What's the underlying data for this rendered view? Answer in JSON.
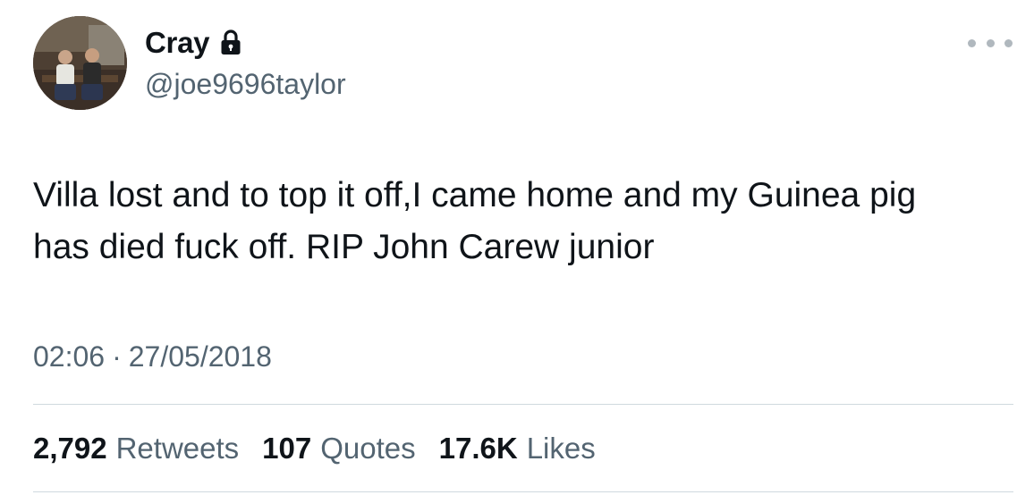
{
  "user": {
    "display_name": "Cray",
    "handle": "@joe9696taylor",
    "protected_icon": "lock-icon",
    "avatar_description": "photo-avatar"
  },
  "tweet": {
    "text": "Villa lost and to top it off,I came home and my Guinea pig\nhas died fuck off. RIP John Carew junior",
    "time": "02:06",
    "separator": "·",
    "date": "27/05/2018"
  },
  "stats": {
    "retweets_count": "2,792",
    "retweets_label": "Retweets",
    "quotes_count": "107",
    "quotes_label": "Quotes",
    "likes_count": "17.6K",
    "likes_label": "Likes"
  },
  "icons": {
    "more": "more-options-icon"
  },
  "colors": {
    "primary_text": "#0f1419",
    "secondary_text": "#536471",
    "divider": "#cfd9de"
  }
}
